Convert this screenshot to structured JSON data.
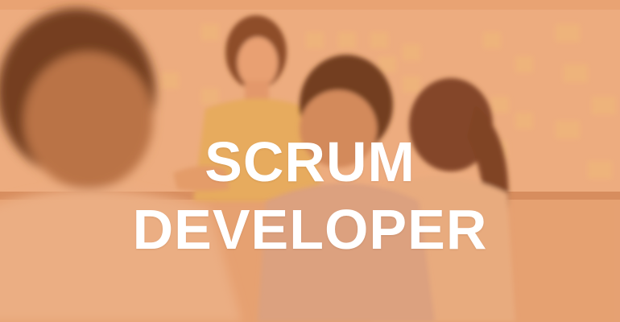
{
  "banner": {
    "title_line1": "SCRUM",
    "title_line2": "DEVELOPER"
  },
  "colors": {
    "overlay": "#e8a070",
    "text": "#ffffff"
  }
}
